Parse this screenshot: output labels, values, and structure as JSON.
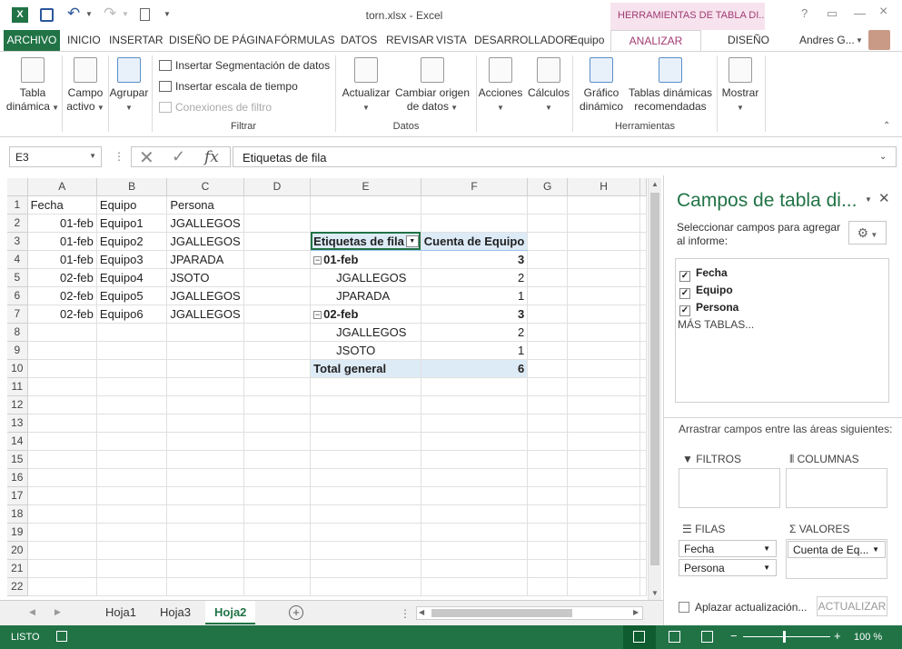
{
  "window": {
    "title": "torn.xlsx - Excel",
    "context_title": "HERRAMIENTAS DE TABLA DI...",
    "user": "Andres G..."
  },
  "tabs": [
    "ARCHIVO",
    "INICIO",
    "INSERTAR",
    "DISEÑO DE PÁGINA",
    "FÓRMULAS",
    "DATOS",
    "REVISAR",
    "VISTA",
    "DESARROLLADOR",
    "Equipo",
    "ANALIZAR",
    "DISEÑO"
  ],
  "ribbon": {
    "tabla_dinamica": [
      "Tabla",
      "dinámica"
    ],
    "campo_activo": [
      "Campo",
      "activo"
    ],
    "agrupar": "Agrupar",
    "insertar_segmentacion": "Insertar Segmentación de datos",
    "insertar_escala": "Insertar escala de tiempo",
    "conexiones": "Conexiones de filtro",
    "filtrar": "Filtrar",
    "actualizar": "Actualizar",
    "cambiar_origen": [
      "Cambiar origen",
      "de datos"
    ],
    "datos": "Datos",
    "acciones": "Acciones",
    "calculos": "Cálculos",
    "grafico": [
      "Gráfico",
      "dinámico"
    ],
    "tablas_recomendadas": [
      "Tablas dinámicas",
      "recomendadas"
    ],
    "herramientas": "Herramientas",
    "mostrar": "Mostrar"
  },
  "formula_bar": {
    "name_box": "E3",
    "formula": "Etiquetas de fila"
  },
  "sheet": {
    "columns": [
      "A",
      "B",
      "C",
      "D",
      "E",
      "F",
      "G",
      "H"
    ],
    "rows": [
      "1",
      "2",
      "3",
      "4",
      "5",
      "6",
      "7",
      "8",
      "9",
      "10",
      "11",
      "12",
      "13",
      "14",
      "15",
      "16",
      "17",
      "18",
      "19",
      "20",
      "21",
      "22"
    ],
    "data": [
      [
        "Fecha",
        "Equipo",
        "Persona"
      ],
      [
        "01-feb",
        "Equipo1",
        "JGALLEGOS"
      ],
      [
        "01-feb",
        "Equipo2",
        "JGALLEGOS"
      ],
      [
        "01-feb",
        "Equipo3",
        "JPARADA"
      ],
      [
        "02-feb",
        "Equipo4",
        "JSOTO"
      ],
      [
        "02-feb",
        "Equipo5",
        "JGALLEGOS"
      ],
      [
        "02-feb",
        "Equipo6",
        "JGALLEGOS"
      ]
    ],
    "pivot": {
      "header_row": "Etiquetas de fila",
      "header_value": "Cuenta de Equipo",
      "rows": [
        {
          "label": "01-feb",
          "value": "3",
          "group": true
        },
        {
          "label": "JGALLEGOS",
          "value": "2",
          "group": false
        },
        {
          "label": "JPARADA",
          "value": "1",
          "group": false
        },
        {
          "label": "02-feb",
          "value": "3",
          "group": true
        },
        {
          "label": "JGALLEGOS",
          "value": "2",
          "group": false
        },
        {
          "label": "JSOTO",
          "value": "1",
          "group": false
        }
      ],
      "total_label": "Total general",
      "total_value": "6"
    }
  },
  "sheet_tabs": [
    "Hoja1",
    "Hoja3",
    "Hoja2"
  ],
  "pane": {
    "title": "Campos de tabla di...",
    "instruction": "Seleccionar campos para agregar al informe:",
    "fields": [
      "Fecha",
      "Equipo",
      "Persona"
    ],
    "more_tables": "MÁS TABLAS...",
    "drag_text": "Arrastrar campos entre las áreas siguientes:",
    "filtros": "FILTROS",
    "columnas": "COLUMNAS",
    "filas": "FILAS",
    "valores": "VALORES",
    "filas_items": [
      "Fecha",
      "Persona"
    ],
    "valores_items": [
      "Cuenta de Eq..."
    ],
    "defer": "Aplazar actualización...",
    "update_button": "ACTUALIZAR"
  },
  "status": {
    "mode": "LISTO",
    "zoom": "100 %"
  }
}
